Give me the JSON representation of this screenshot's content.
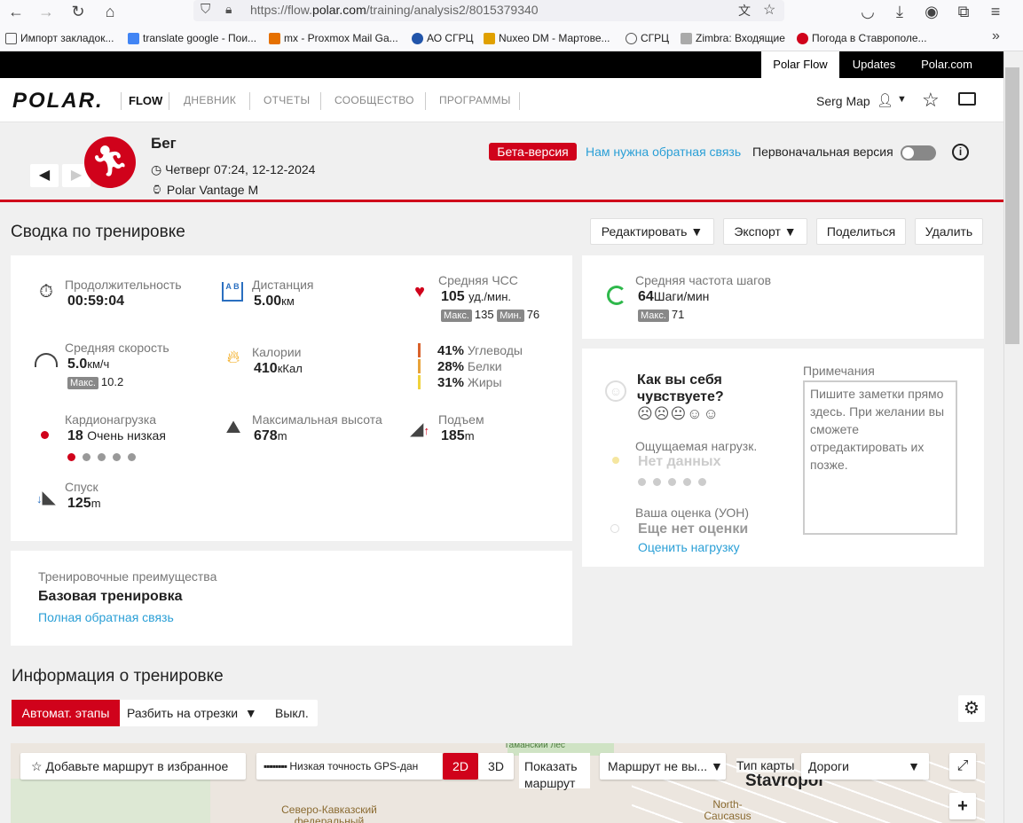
{
  "browser": {
    "url_prefix": "https://flow.",
    "url_domain": "polar.com",
    "url_path": "/training/analysis2/8015379340",
    "bookmarks": [
      {
        "label": "Импорт закладок...",
        "color": "#555"
      },
      {
        "label": "translate google - Пои...",
        "color": "#4285f4"
      },
      {
        "label": "mx - Proxmox Mail Ga...",
        "color": "#e57000"
      },
      {
        "label": "АО СГРЦ",
        "color": "#2255aa"
      },
      {
        "label": "Nuxeo DM - Мартове...",
        "color": "#e0a000"
      },
      {
        "label": "СГРЦ",
        "color": "#555"
      },
      {
        "label": "Zimbra: Входящие",
        "color": "#888"
      },
      {
        "label": "Погода в Ставрополе...",
        "color": "#d0021b"
      }
    ]
  },
  "topbar": {
    "tabs": [
      "Polar Flow",
      "Updates",
      "Polar.com"
    ]
  },
  "header": {
    "logo": "POLAR.",
    "flow": "FLOW",
    "nav": [
      "ДНЕВНИК",
      "ОТЧЕТЫ",
      "СООБЩЕСТВО",
      "ПРОГРАММЫ"
    ],
    "user": "Serg Map"
  },
  "activity": {
    "title": "Бег",
    "date": "Четверг 07:24, 12-12-2024",
    "device": "Polar Vantage M",
    "beta": "Бета-версия",
    "feedback": "Нам нужна обратная связь",
    "original": "Первоначальная версия"
  },
  "summary": {
    "title": "Сводка по тренировке",
    "buttons": {
      "edit": "Редактировать",
      "export": "Экспорт",
      "share": "Поделиться",
      "delete": "Удалить"
    },
    "duration": {
      "label": "Продолжительность",
      "value": "00:59:04"
    },
    "distance": {
      "label": "Дистанция",
      "value": "5.00",
      "unit": "км"
    },
    "hr": {
      "label": "Средняя ЧСС",
      "value": "105",
      "unit": "уд./мин.",
      "max_tag": "Макс.",
      "max": "135",
      "min_tag": "Мин.",
      "min": "76"
    },
    "speed": {
      "label": "Средняя скорость",
      "value": "5.0",
      "unit": "км/ч",
      "max_tag": "Макс.",
      "max": "10.2"
    },
    "calories": {
      "label": "Калории",
      "value": "410",
      "unit": "кКал"
    },
    "macros": [
      {
        "pct": "41%",
        "name": "Углеводы",
        "color": "#d9622b"
      },
      {
        "pct": "28%",
        "name": "Белки",
        "color": "#e8a33a"
      },
      {
        "pct": "31%",
        "name": "Жиры",
        "color": "#f0d23c"
      }
    ],
    "cardio": {
      "label": "Кардионагрузка",
      "value": "18",
      "text": "Очень низкая",
      "level": 1
    },
    "altitude": {
      "label": "Максимальная высота",
      "value": "678",
      "unit": "m"
    },
    "ascent": {
      "label": "Подъем",
      "value": "185",
      "unit": "m"
    },
    "descent": {
      "label": "Спуск",
      "value": "125",
      "unit": "m"
    },
    "cadence": {
      "label": "Средняя частота шагов",
      "value": "64",
      "unit": "Шаги/мин",
      "max_tag": "Макс.",
      "max": "71"
    }
  },
  "benefit": {
    "label": "Тренировочные преимущества",
    "value": "Базовая тренировка",
    "link": "Полная обратная связь"
  },
  "feeling": {
    "question": "Как вы себя чувствуете?",
    "perceived_label": "Ощущаемая нагрузк.",
    "perceived_value": "Нет данных",
    "rpe_label": "Ваша оценка (УОН)",
    "rpe_value": "Еще нет оценки",
    "rpe_link": "Оценить нагрузку",
    "notes_label": "Примечания",
    "notes_placeholder": "Пишите заметки прямо здесь. При желании вы сможете отредактировать их позже."
  },
  "training_info": {
    "title": "Информация о тренировке",
    "auto_laps": "Автомат. этапы",
    "split": "Разбить на отрезки",
    "off": "Выкл."
  },
  "map": {
    "favorite": "Добавьте маршрут в избранное",
    "gps": "Низкая точность GPS-дан",
    "mode_2d": "2D",
    "mode_3d": "3D",
    "show_route": "Показать маршрут",
    "route_select": "Маршрут не вы...",
    "map_type_label": "Тип карты",
    "map_type": "Дороги",
    "labels": {
      "city": "Stavropol",
      "univ_en": "North-Caucasus Federal University",
      "univ_ru": "Северо-Кавказский федеральный",
      "forest": "Таманский лес"
    }
  }
}
